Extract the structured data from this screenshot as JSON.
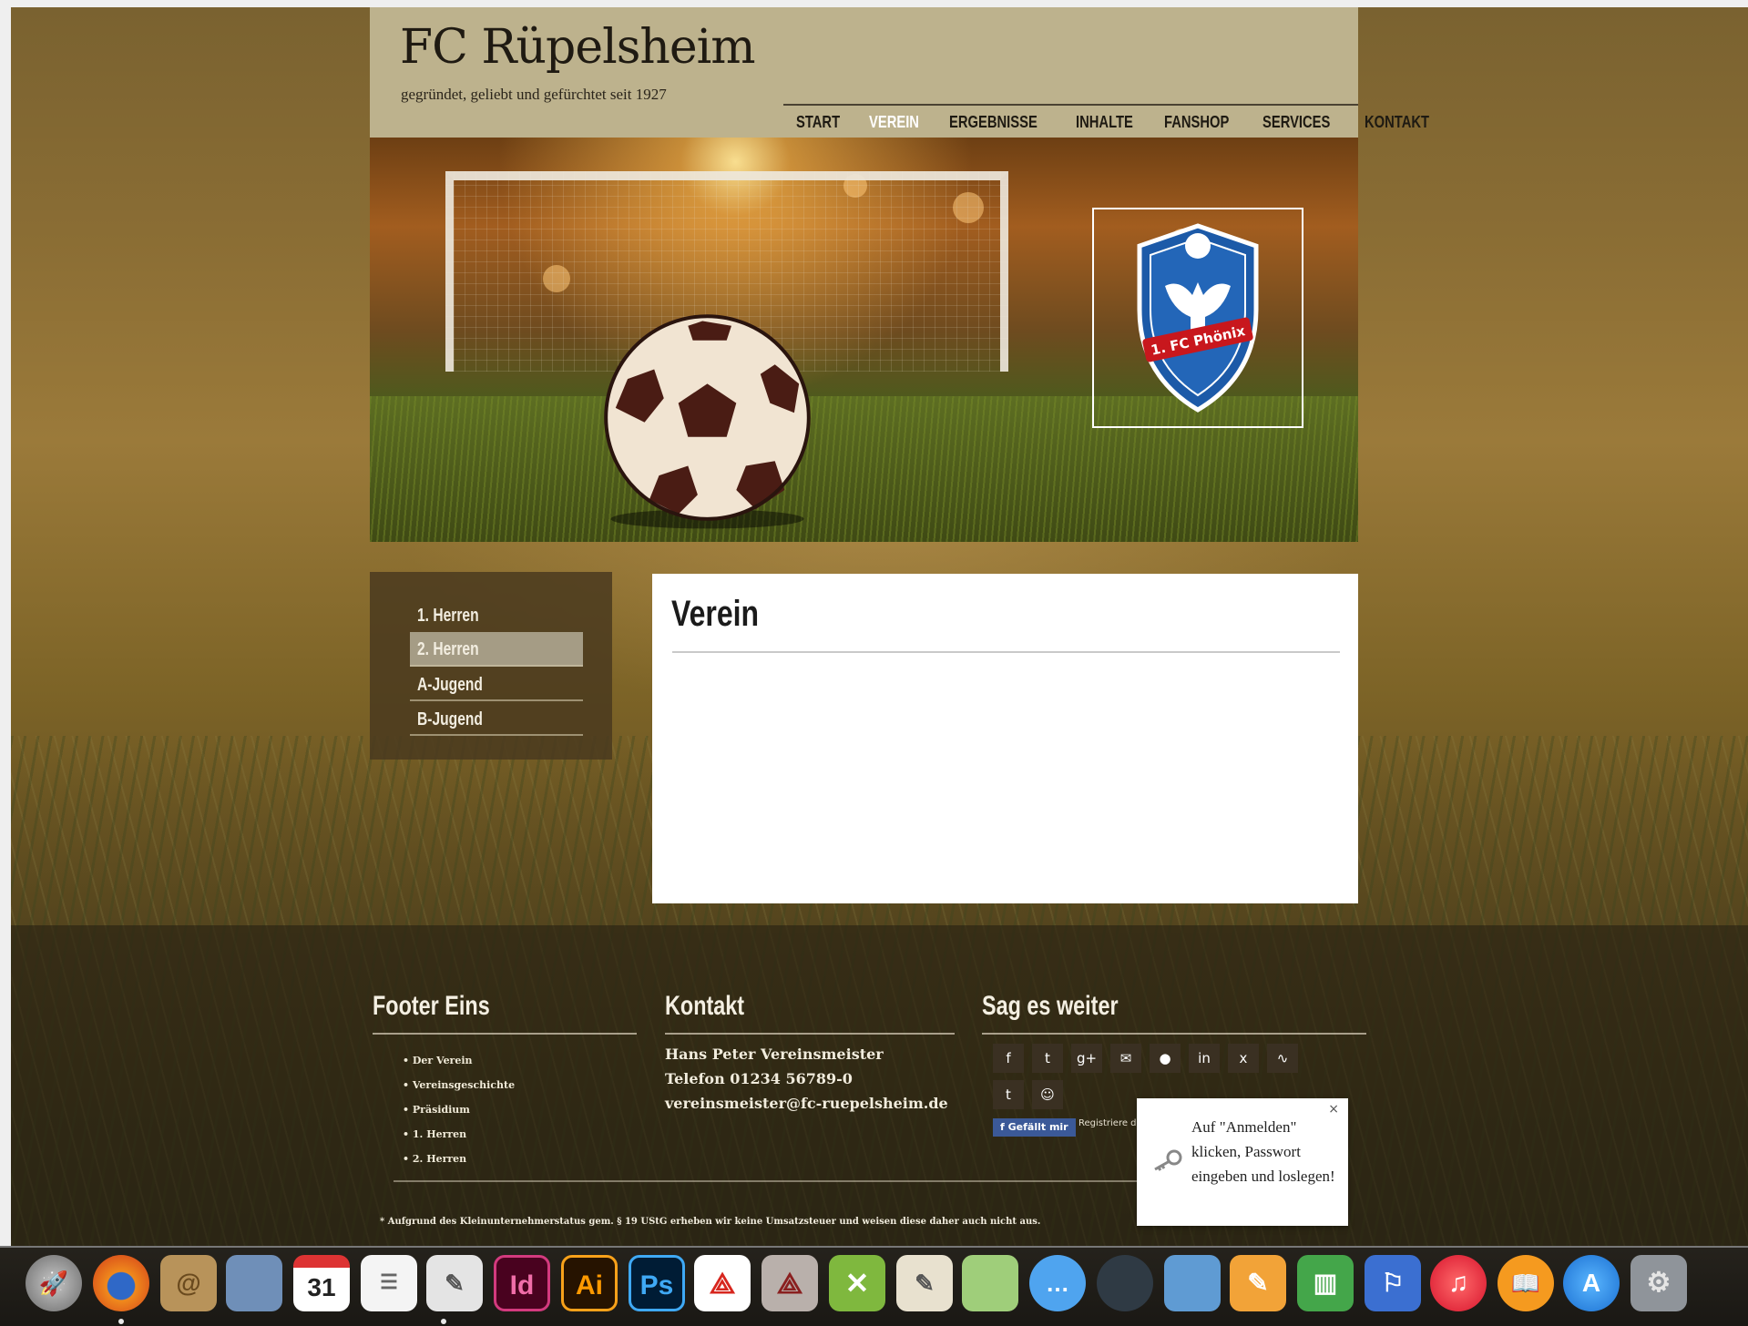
{
  "header": {
    "title": "FC Rüpelsheim",
    "tagline": "gegründet, geliebt und gefürchtet seit 1927"
  },
  "nav": {
    "items": [
      {
        "label": "START"
      },
      {
        "label": "VEREIN",
        "active": true
      },
      {
        "label": "ERGEBNISSE"
      },
      {
        "label": "INHALTE"
      },
      {
        "label": "FANSHOP"
      },
      {
        "label": "SERVICES"
      },
      {
        "label": "KONTAKT"
      }
    ]
  },
  "hero": {
    "crest_text": "1. FC Phönix"
  },
  "sidebar": {
    "items": [
      {
        "label": "1. Herren"
      },
      {
        "label": "2. Herren",
        "active": true
      },
      {
        "label": "A-Jugend"
      },
      {
        "label": "B-Jugend"
      }
    ]
  },
  "content": {
    "title": "Verein"
  },
  "footer": {
    "col1_title": "Footer Eins",
    "links": [
      "Der Verein",
      "Vereinsgeschichte",
      "Präsidium",
      "1. Herren",
      "2. Herren"
    ],
    "col2_title": "Kontakt",
    "contact": [
      "Hans Peter Vereinsmeister",
      "Telefon 01234 56789-0",
      "vereinsmeister@fc-ruepelsheim.de"
    ],
    "col3_title": "Sag es weiter",
    "share_icons": [
      "facebook-icon",
      "twitter-icon",
      "google-plus-icon",
      "email-icon",
      "comment-icon",
      "linkedin-icon",
      "xing-icon",
      "stumbleupon-icon",
      "tumblr-icon",
      "reddit-icon"
    ],
    "fb_like_label": "Gefällt mir",
    "fb_register_text": "Registriere d",
    "footnote": "* Aufgrund des Kleinunternehmerstatus gem. § 19 UStG erheben wir keine Umsatzsteuer und weisen diese daher auch nicht aus."
  },
  "popup": {
    "text": "Auf \"Anmelden\" klicken, Passwort eingeben und loslegen!",
    "close_label": "×"
  },
  "dock": {
    "apps": [
      "Rocket",
      "Firefox",
      "Contacts",
      "Preview",
      "Calendar",
      "Reminders",
      "TextEdit",
      "Id",
      "Ai",
      "Ps",
      "Acrobat",
      "Reader",
      "X",
      "Script Editor",
      "Maps",
      "Messages",
      "FaceTime",
      "iPhoto",
      "Pages",
      "Numbers",
      "Keynote",
      "iTunes",
      "iBooks",
      "App Store",
      "System Preferences"
    ],
    "calendar_day": "31",
    "colors": {
      "indesign": "#49021f",
      "illustrator": "#261300",
      "photoshop": "#001c35"
    }
  }
}
